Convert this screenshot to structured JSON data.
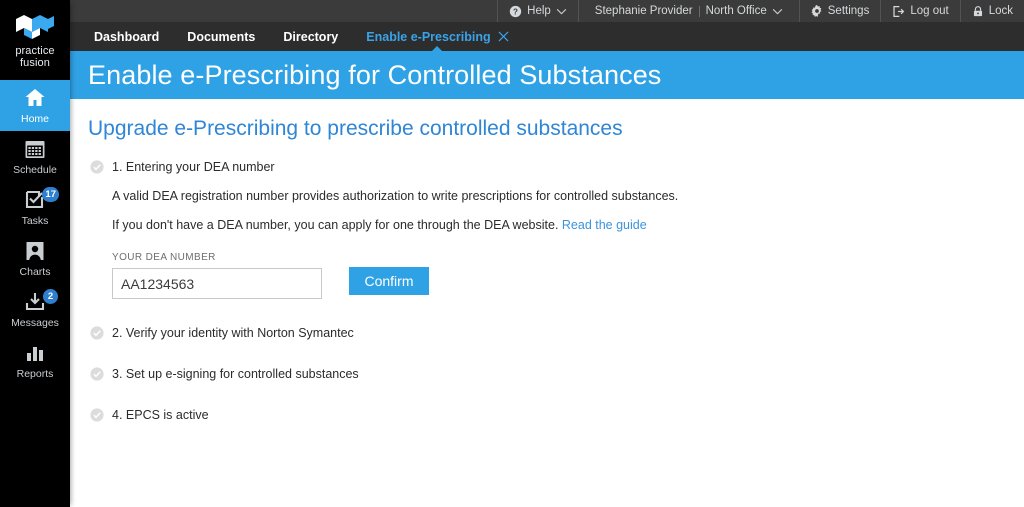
{
  "brand": {
    "name_line1": "practice",
    "name_line2": "fusion",
    "logo_icon": "practice-fusion-logo",
    "accent_color": "#2fa2e6"
  },
  "topbar": {
    "help": {
      "label": "Help",
      "icon": "question-circle-icon",
      "chevron": "chevron-down-icon"
    },
    "user": {
      "name": "Stephanie Provider"
    },
    "office": {
      "name": "North Office",
      "chevron": "chevron-down-icon"
    },
    "settings": {
      "label": "Settings",
      "icon": "gear-icon"
    },
    "logout": {
      "label": "Log out",
      "icon": "logout-icon"
    },
    "lock": {
      "label": "Lock",
      "icon": "lock-icon"
    }
  },
  "tabs": [
    {
      "label": "Dashboard",
      "active": false,
      "closable": false
    },
    {
      "label": "Documents",
      "active": false,
      "closable": false
    },
    {
      "label": "Directory",
      "active": false,
      "closable": false
    },
    {
      "label": "Enable e-Prescribing",
      "active": true,
      "closable": true,
      "close_icon": "close-icon"
    }
  ],
  "sidebar": {
    "items": [
      {
        "label": "Home",
        "icon": "home-icon",
        "active": true,
        "badge": null
      },
      {
        "label": "Schedule",
        "icon": "calendar-icon",
        "active": false,
        "badge": null
      },
      {
        "label": "Tasks",
        "icon": "task-checkbox-icon",
        "active": false,
        "badge": "17"
      },
      {
        "label": "Charts",
        "icon": "person-icon",
        "active": false,
        "badge": null
      },
      {
        "label": "Messages",
        "icon": "inbox-download-icon",
        "active": false,
        "badge": "2"
      },
      {
        "label": "Reports",
        "icon": "bar-chart-icon",
        "active": false,
        "badge": null
      }
    ]
  },
  "banner": {
    "title": "Enable e-Prescribing for Controlled Substances"
  },
  "main": {
    "subheading": "Upgrade e-Prescribing to prescribe controlled substances",
    "steps": [
      {
        "check_icon": "check-circle-icon",
        "title": "1. Entering your DEA number",
        "paragraph1": "A valid DEA registration number provides authorization to write prescriptions for controlled substances.",
        "paragraph2_pre": "If you don't have a DEA number, you can apply for one through the DEA website. ",
        "paragraph2_link": "Read the guide",
        "field_label": "YOUR DEA NUMBER",
        "field_value": "AA1234563",
        "field_placeholder": "Enter DEA number",
        "button_label": "Confirm"
      },
      {
        "check_icon": "check-circle-icon",
        "title": "2. Verify your identity with Norton Symantec"
      },
      {
        "check_icon": "check-circle-icon",
        "title": "3. Set up e-signing for controlled substances"
      },
      {
        "check_icon": "check-circle-icon",
        "title": "4. EPCS is active"
      }
    ]
  }
}
